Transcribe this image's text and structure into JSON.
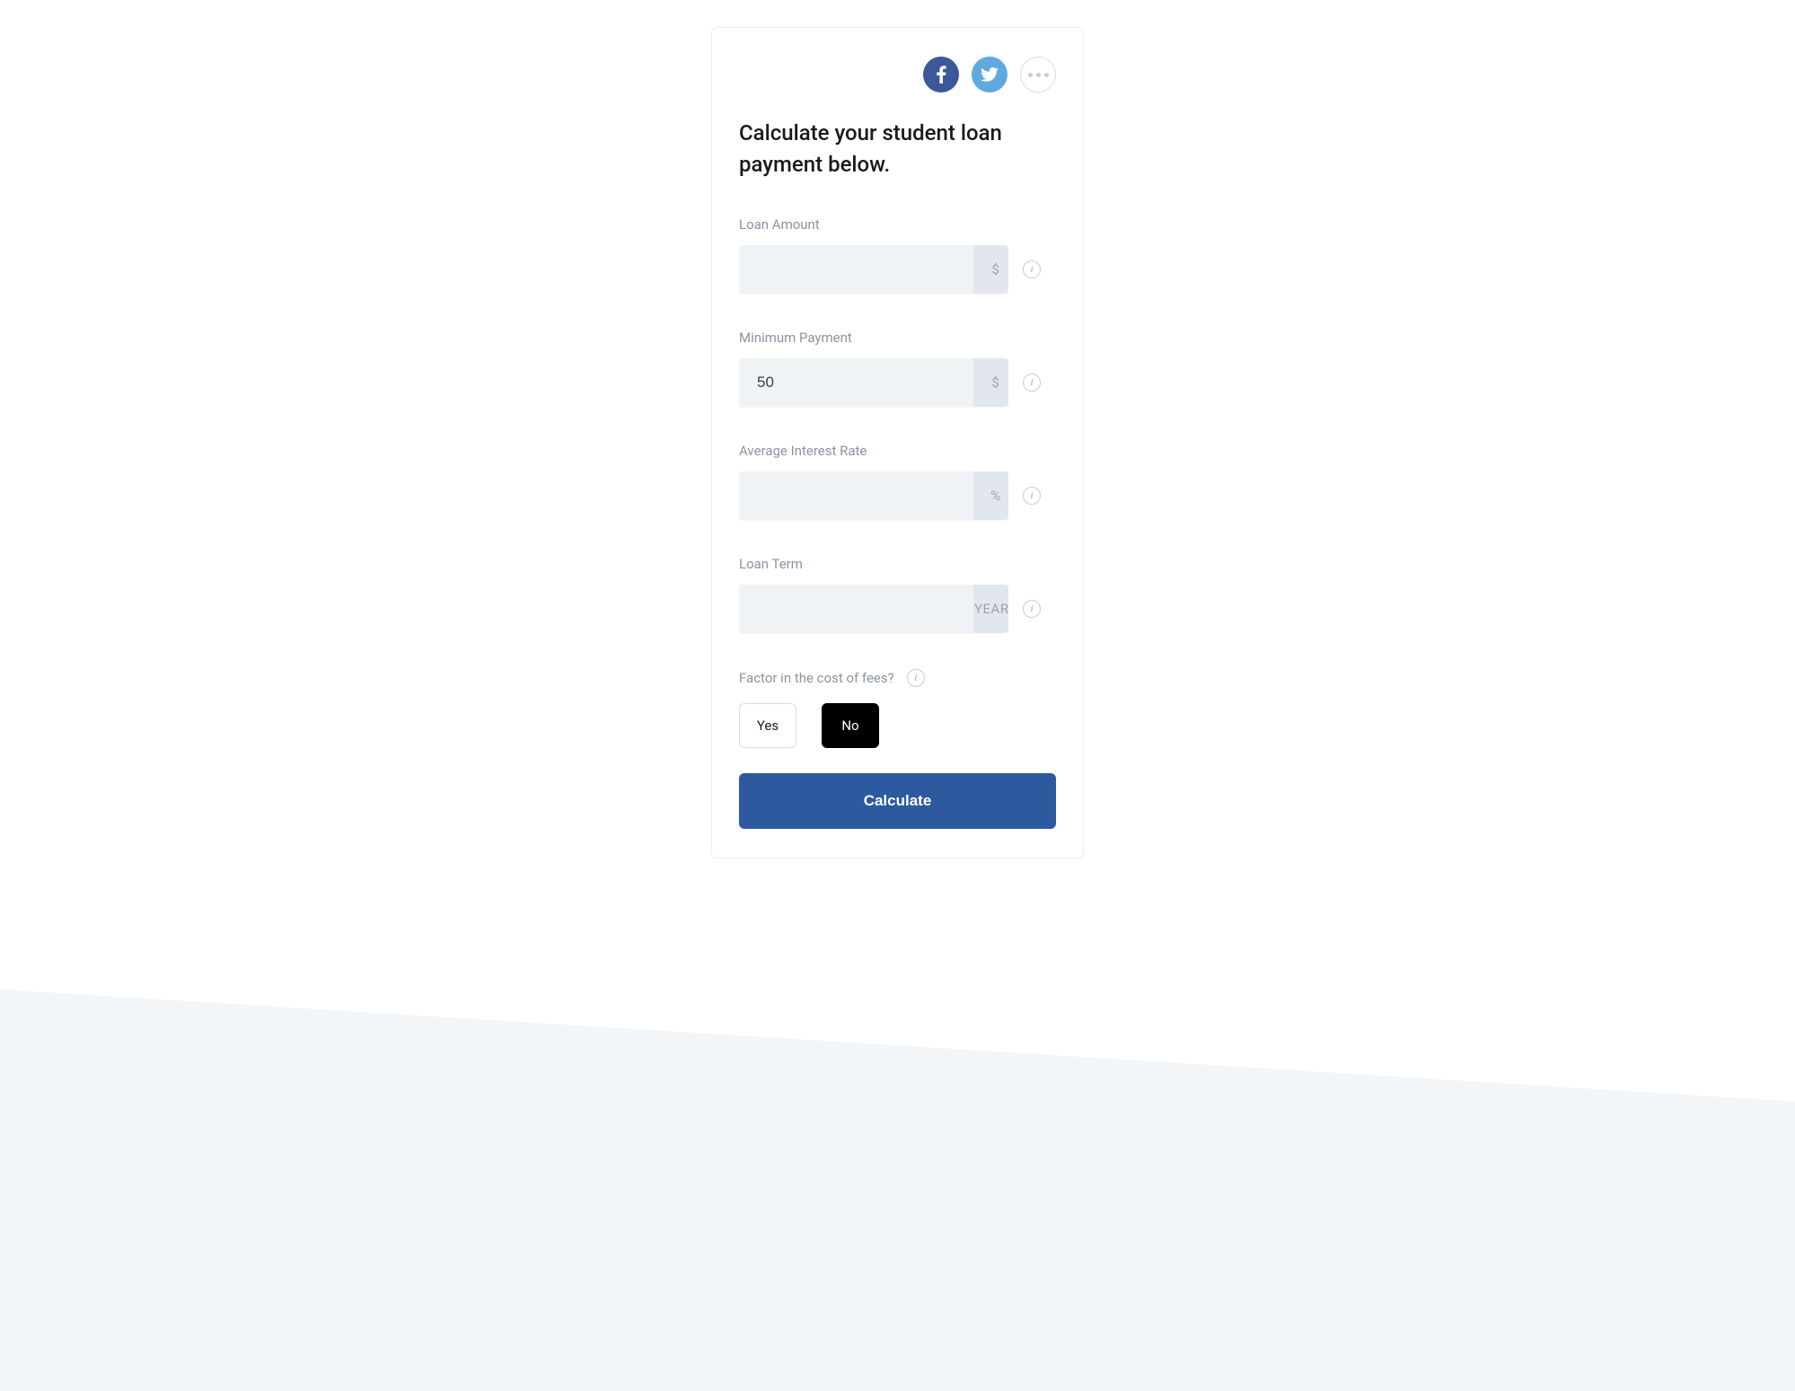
{
  "social": {
    "facebook_name": "facebook",
    "twitter_name": "twitter",
    "more_name": "more"
  },
  "heading": "Calculate your student loan payment below.",
  "fields": {
    "loan_amount": {
      "label": "Loan Amount",
      "value": "",
      "suffix": "$"
    },
    "minimum_payment": {
      "label": "Minimum Payment",
      "value": "50",
      "suffix": "$"
    },
    "interest_rate": {
      "label": "Average Interest Rate",
      "value": "",
      "suffix": "%"
    },
    "loan_term": {
      "label": "Loan Term",
      "value": "",
      "suffix": "YEARS"
    }
  },
  "fees": {
    "label": "Factor in the cost of fees?",
    "yes_label": "Yes",
    "no_label": "No",
    "selected": "no"
  },
  "calculate_label": "Calculate"
}
